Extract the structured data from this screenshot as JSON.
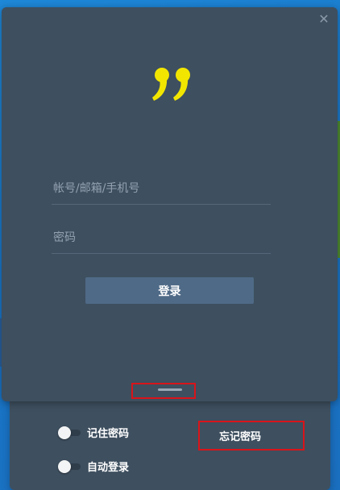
{
  "login": {
    "close_icon": "close-icon",
    "logo_icon": "double-quote-logo",
    "logo_color": "#f2e600",
    "account_placeholder": "帐号/邮箱/手机号",
    "account_value": "",
    "password_placeholder": "密码",
    "password_value": "",
    "login_label": "登录",
    "accent_color": "#4f6a87"
  },
  "options": {
    "remember_password_label": "记住密码",
    "remember_password_on": false,
    "auto_login_label": "自动登录",
    "auto_login_on": false,
    "forgot_password_label": "忘记密码"
  },
  "highlight_color": "#d9141a"
}
